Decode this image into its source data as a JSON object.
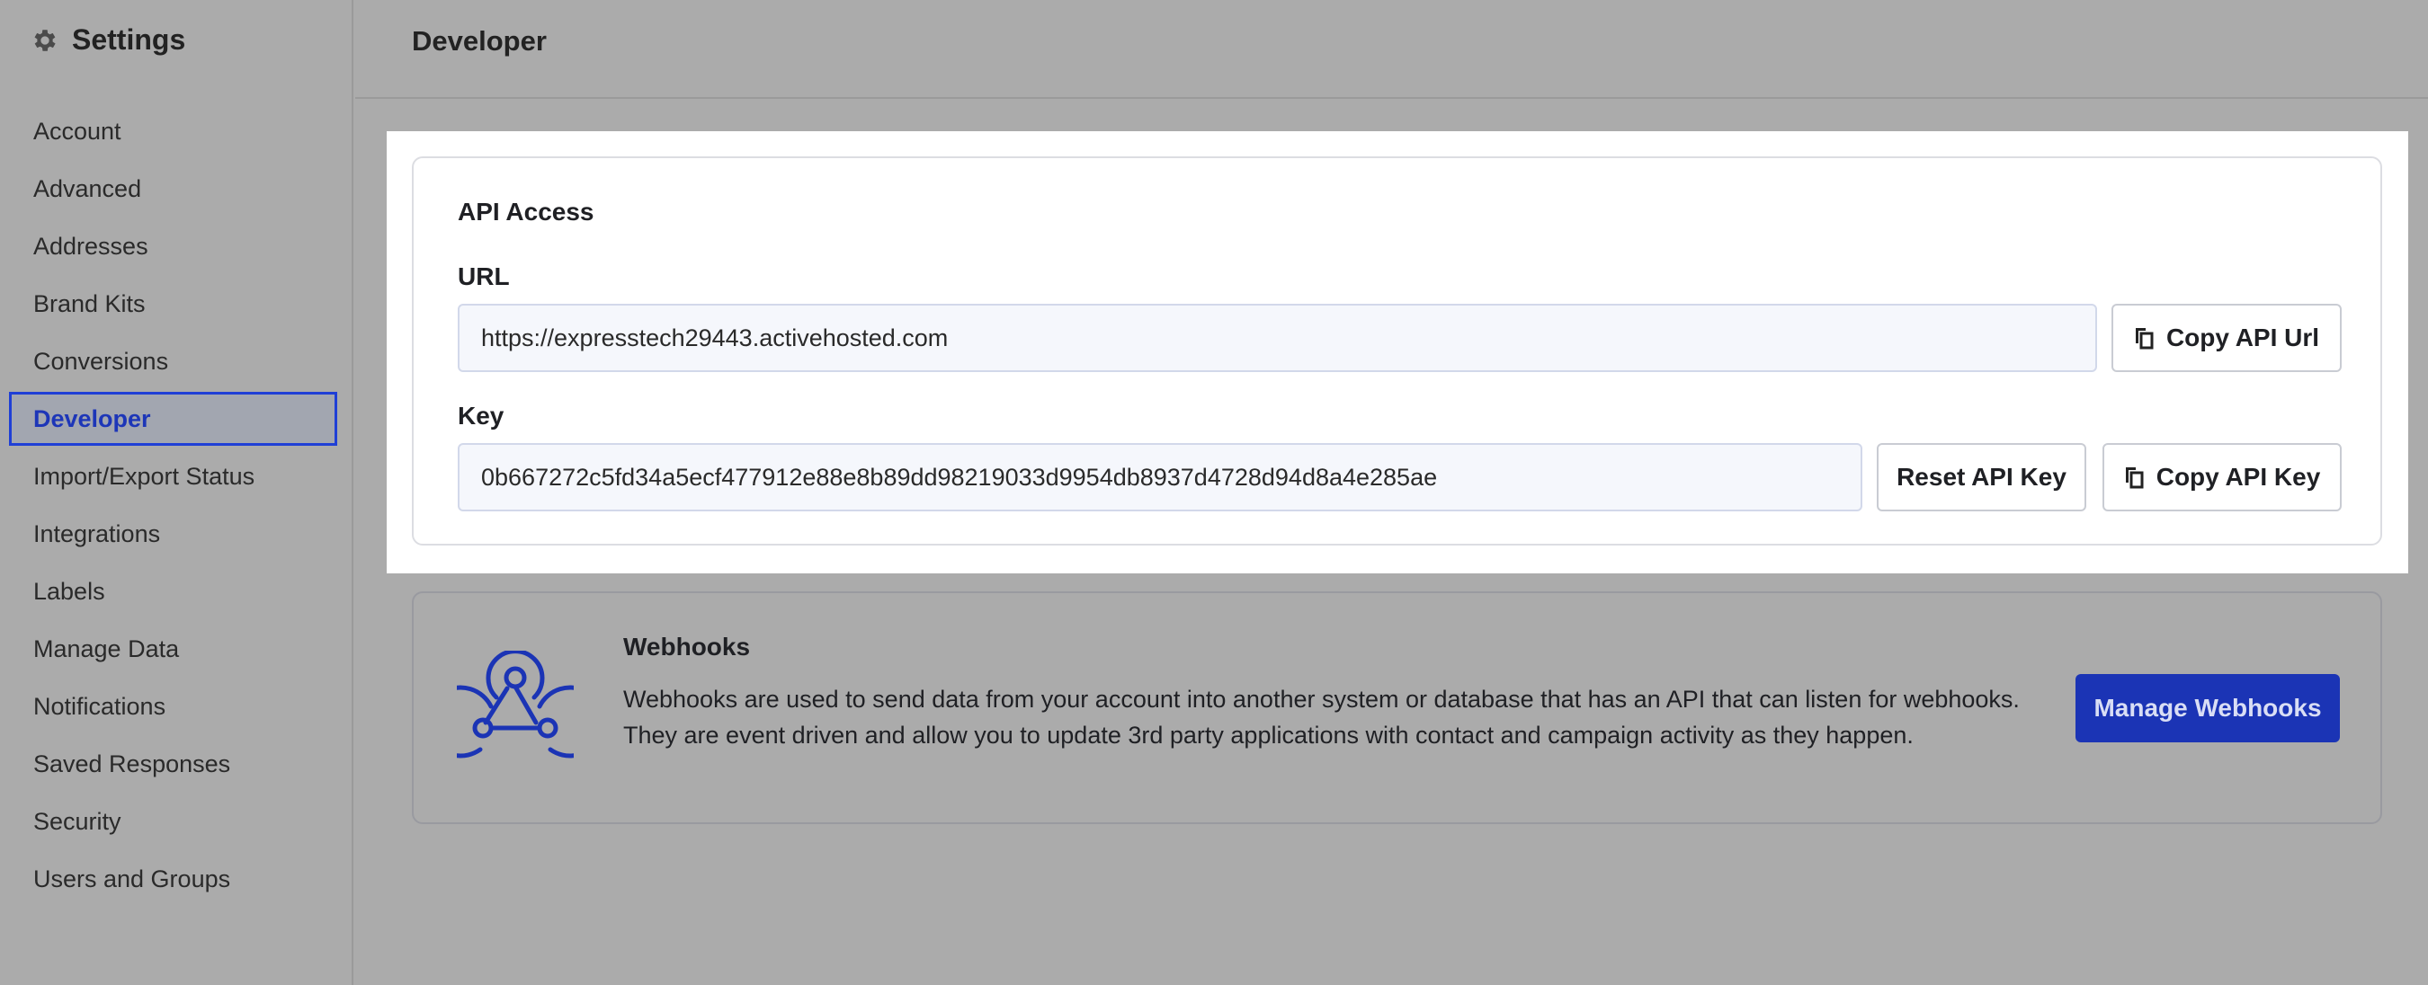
{
  "sidebar": {
    "title": "Settings",
    "items": [
      {
        "label": "Account"
      },
      {
        "label": "Advanced"
      },
      {
        "label": "Addresses"
      },
      {
        "label": "Brand Kits"
      },
      {
        "label": "Conversions"
      },
      {
        "label": "Developer",
        "active": true
      },
      {
        "label": "Import/Export Status"
      },
      {
        "label": "Integrations"
      },
      {
        "label": "Labels"
      },
      {
        "label": "Manage Data"
      },
      {
        "label": "Notifications"
      },
      {
        "label": "Saved Responses"
      },
      {
        "label": "Security"
      },
      {
        "label": "Users and Groups"
      }
    ]
  },
  "header": {
    "title": "Developer"
  },
  "api_access": {
    "title": "API Access",
    "url_label": "URL",
    "url_value": "https://expresstech29443.activehosted.com",
    "copy_url_label": "Copy API Url",
    "key_label": "Key",
    "key_value": "0b667272c5fd34a5ecf477912e88e8b89dd98219033d9954db8937d4728d94d8a4e285ae",
    "reset_key_label": "Reset API Key",
    "copy_key_label": "Copy API Key"
  },
  "webhooks": {
    "title": "Webhooks",
    "description": "Webhooks are used to send data from your account into another system or database that has an API that can listen for webhooks. They are event driven and allow you to update 3rd party applications with contact and campaign activity as they happen.",
    "button_label": "Manage Webhooks"
  },
  "colors": {
    "accent": "#1b34b5",
    "active_border": "#1f3fd6",
    "overlay_gray": "#ababab"
  },
  "icons": {
    "settings": "gear-icon",
    "copy": "copy-icon",
    "webhooks": "webhook-icon"
  }
}
